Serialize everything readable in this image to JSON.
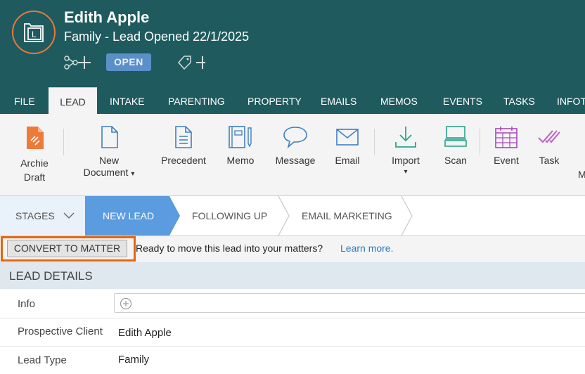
{
  "header": {
    "client_name": "Edith Apple",
    "subtitle": "Family - Lead Opened 22/1/2025",
    "status_badge": "OPEN",
    "avatar_letter": "L"
  },
  "tabs": [
    {
      "label": "FILE",
      "active": false
    },
    {
      "label": "LEAD",
      "active": true
    },
    {
      "label": "INTAKE",
      "active": false
    },
    {
      "label": "PARENTING",
      "active": false
    },
    {
      "label": "PROPERTY",
      "active": false
    },
    {
      "label": "EMAILS",
      "active": false
    },
    {
      "label": "MEMOS",
      "active": false
    },
    {
      "label": "EVENTS",
      "active": false
    },
    {
      "label": "TASKS",
      "active": false
    },
    {
      "label": "INFOT",
      "active": false
    }
  ],
  "ribbon": {
    "archie_draft": {
      "line1": "Archie",
      "line2": "Draft",
      "icon": "archie-draft-icon"
    },
    "new_document": {
      "line1": "New",
      "line2": "Document",
      "caret": "▾",
      "icon": "new-document-icon"
    },
    "precedent": {
      "label": "Precedent",
      "icon": "precedent-icon"
    },
    "memo": {
      "label": "Memo",
      "icon": "memo-icon"
    },
    "message": {
      "label": "Message",
      "icon": "message-icon"
    },
    "email": {
      "label": "Email",
      "icon": "email-icon"
    },
    "import": {
      "label": "Import",
      "caret": "▾",
      "icon": "import-icon"
    },
    "scan": {
      "label": "Scan",
      "icon": "scan-icon"
    },
    "event": {
      "label": "Event",
      "icon": "event-icon"
    },
    "task": {
      "label": "Task",
      "icon": "task-icon"
    },
    "overflow": {
      "label": "M"
    }
  },
  "stages": {
    "menu_label": "STAGES",
    "items": [
      {
        "label": "NEW LEAD",
        "active": true
      },
      {
        "label": "FOLLOWING UP",
        "active": false
      },
      {
        "label": "EMAIL MARKETING",
        "active": false
      }
    ]
  },
  "convert": {
    "button_label": "CONVERT TO MATTER",
    "prompt": "Ready to move this lead into your matters?",
    "link": "Learn more."
  },
  "lead_details": {
    "title": "LEAD DETAILS",
    "fields": [
      {
        "label": "Info",
        "value": ""
      },
      {
        "label": "Prospective Client",
        "value": "Edith Apple"
      },
      {
        "label": "Lead Type",
        "value": "Family"
      }
    ]
  },
  "colors": {
    "header_bg": "#1f5b5e",
    "accent_orange": "#e8650d",
    "active_stage": "#5b9be0",
    "badge": "#5a8fc8",
    "link": "#2b79c2"
  }
}
